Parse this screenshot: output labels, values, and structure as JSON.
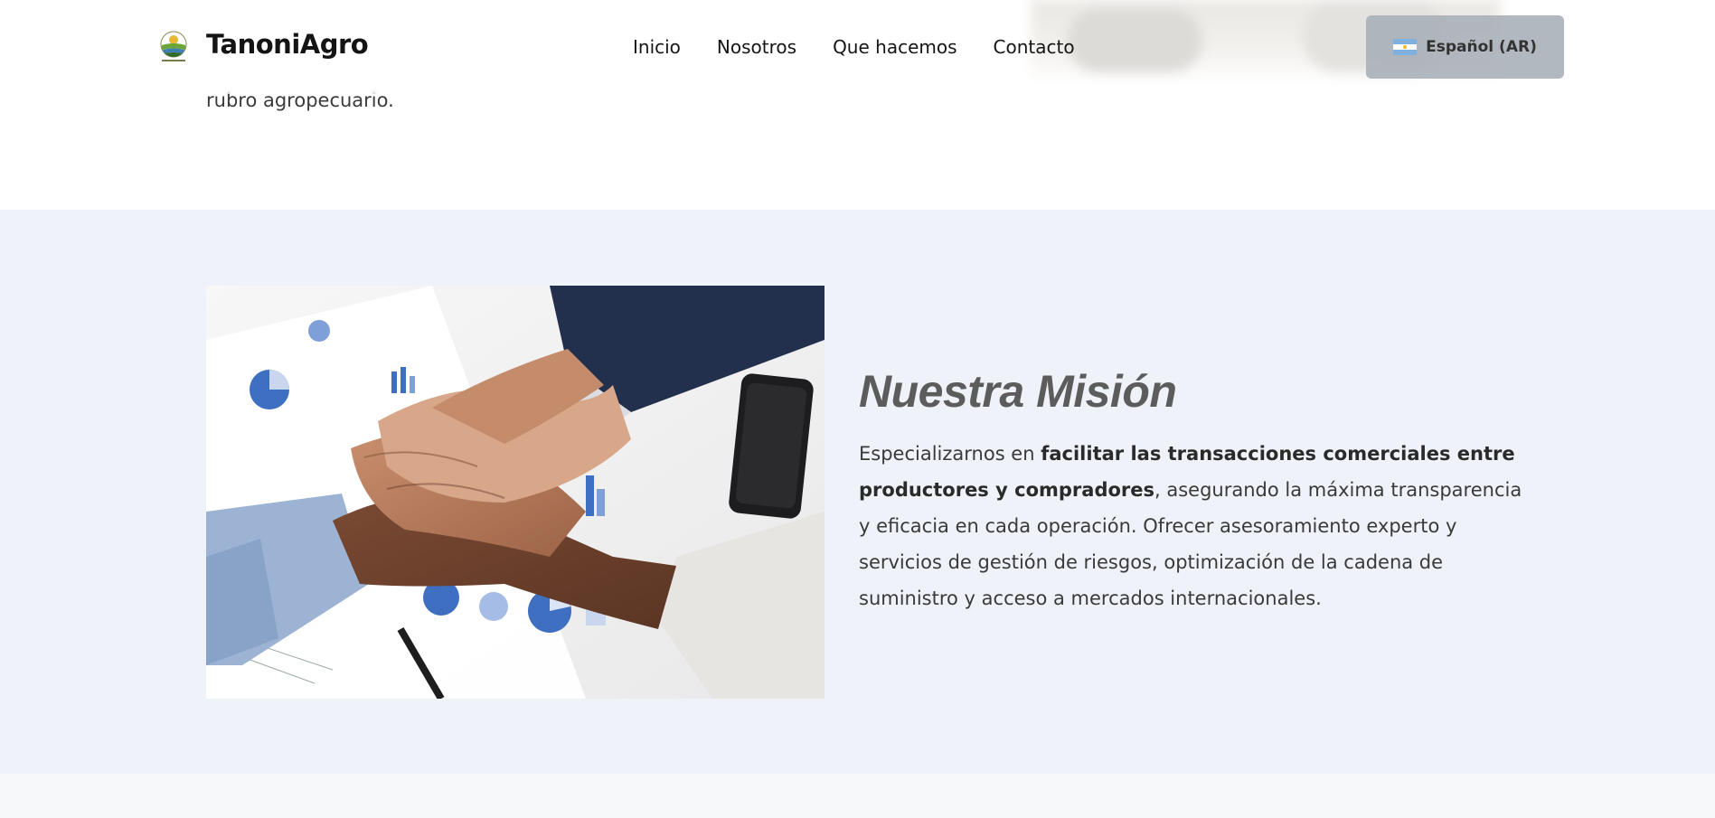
{
  "header": {
    "brand": "TanoniAgro",
    "nav": [
      {
        "label": "Inicio"
      },
      {
        "label": "Nosotros"
      },
      {
        "label": "Que hacemos"
      },
      {
        "label": "Contacto"
      }
    ],
    "language": {
      "label": "Español (AR)",
      "flag": "argentina-flag-icon"
    }
  },
  "previous_section": {
    "text_tail": "rubro agropecuario."
  },
  "mission": {
    "title": "Nuestra Misión",
    "text_prefix": "Especializarnos en ",
    "text_bold": "facilitar las transacciones comerciales entre productores y compradores",
    "text_suffix": ", asegurando la máxima transparencia y eficacia en cada operación. Ofrecer asesoramiento experto y servicios de gestión de riesgos, optimización de la cadena de suministro y acceso a mercados internacionales."
  },
  "colors": {
    "mission_bg": "#eff2f8",
    "lang_button_bg": "#a9b0b8",
    "title_color": "#5c5c5c"
  }
}
